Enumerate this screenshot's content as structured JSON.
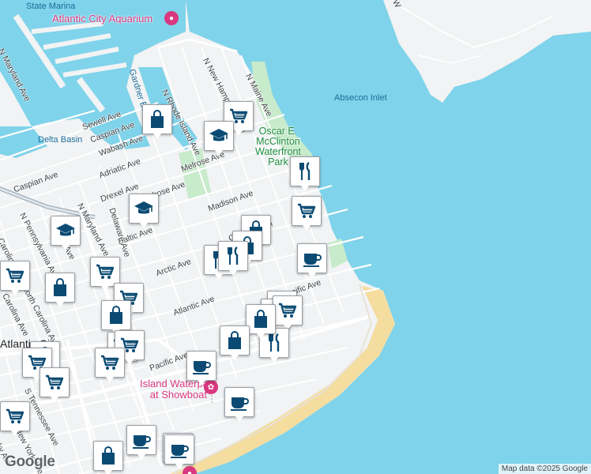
{
  "map": {
    "colors": {
      "water": "#7fd3ea",
      "land": "#f1f3f4",
      "park": "#c8ebcc",
      "beach": "#f5dda0",
      "road": "#ffffff",
      "marker_icon": "#0b4b73",
      "poi_pink": "#d93880",
      "poi_green": "#1e8e3e"
    },
    "water_labels": {
      "state_marina": "State Marina",
      "absecon_inlet": "Absecon Inlet",
      "delta_basin": "Delta Basin",
      "gardner_basin": "Gardner Basin"
    },
    "pois": {
      "aquarium": "Atlantic City Aquarium",
      "waterpark_line1": "Island Waterpark",
      "waterpark_line2": "at Showboat",
      "park_line1": "Oscar E.",
      "park_line2": "McClinton",
      "park_line3": "Waterfront",
      "park_line4": "Park",
      "city_partial": "Atlantic Cit"
    },
    "streets": {
      "maryland_top": "N Maryland Ave",
      "sewell": "Sewell Ave",
      "caspian_upper": "Caspian Ave",
      "wabash": "Wabash Ave",
      "adriatic": "Adriatic Ave",
      "drexel": "Drexel Ave",
      "melrose_left": "Melrose Ave",
      "melrose_right": "Melrose Ave",
      "madison": "Madison Ave",
      "baltic": "Baltic Ave",
      "arctic": "Arctic Ave",
      "atlantic": "Atlantic Ave",
      "pacific_left": "Pacific Ave",
      "pacific_right": "Pacific Ave",
      "gramercy": "Gramercy Pl",
      "caspian_left": "Caspian Ave",
      "delaware": "Delaware Ave",
      "maryland_mid": "N Maryland Ave",
      "pennsylvania": "N Pennsylvania Ave",
      "north_carolina": "N North Carolina Ave",
      "carolina_left": "Carolina Ave",
      "carolina_left2": "Carolina Ave",
      "rhode_island": "N Rhode Island Ave",
      "new_hampshire": "N New Hampshire Ave",
      "maine": "N Maine Ave",
      "tennessee": "S Tennessee Ave",
      "york": "New York Ave",
      "w_frag": "W",
      "ky_frag": "ky Ave",
      "ave_frag": "Ave"
    },
    "markers": [
      {
        "type": "shopping"
      },
      {
        "type": "shopping"
      },
      {
        "type": "school"
      },
      {
        "type": "school"
      },
      {
        "type": "school"
      },
      {
        "type": "restaurant"
      },
      {
        "type": "shopping"
      },
      {
        "type": "shopping"
      },
      {
        "type": "restaurant"
      },
      {
        "type": "shopping"
      },
      {
        "type": "shopping"
      },
      {
        "type": "restaurant"
      },
      {
        "type": "cafe"
      },
      {
        "type": "shopping"
      },
      {
        "type": "shopping"
      },
      {
        "type": "shopping"
      },
      {
        "type": "shopping"
      },
      {
        "type": "shopping"
      },
      {
        "type": "shopping"
      },
      {
        "type": "shopping"
      },
      {
        "type": "shopping"
      },
      {
        "type": "shopping"
      },
      {
        "type": "shopping"
      },
      {
        "type": "restaurant"
      },
      {
        "type": "shopping"
      },
      {
        "type": "shopping"
      },
      {
        "type": "restaurant"
      },
      {
        "type": "shopping"
      },
      {
        "type": "cafe"
      },
      {
        "type": "cafe"
      },
      {
        "type": "shopping"
      },
      {
        "type": "shopping"
      },
      {
        "type": "cafe"
      },
      {
        "type": "cafe"
      },
      {
        "type": "shopping"
      },
      {
        "type": "cafe"
      }
    ],
    "logo": "Google",
    "attribution": "Map data ©2025 Google"
  }
}
